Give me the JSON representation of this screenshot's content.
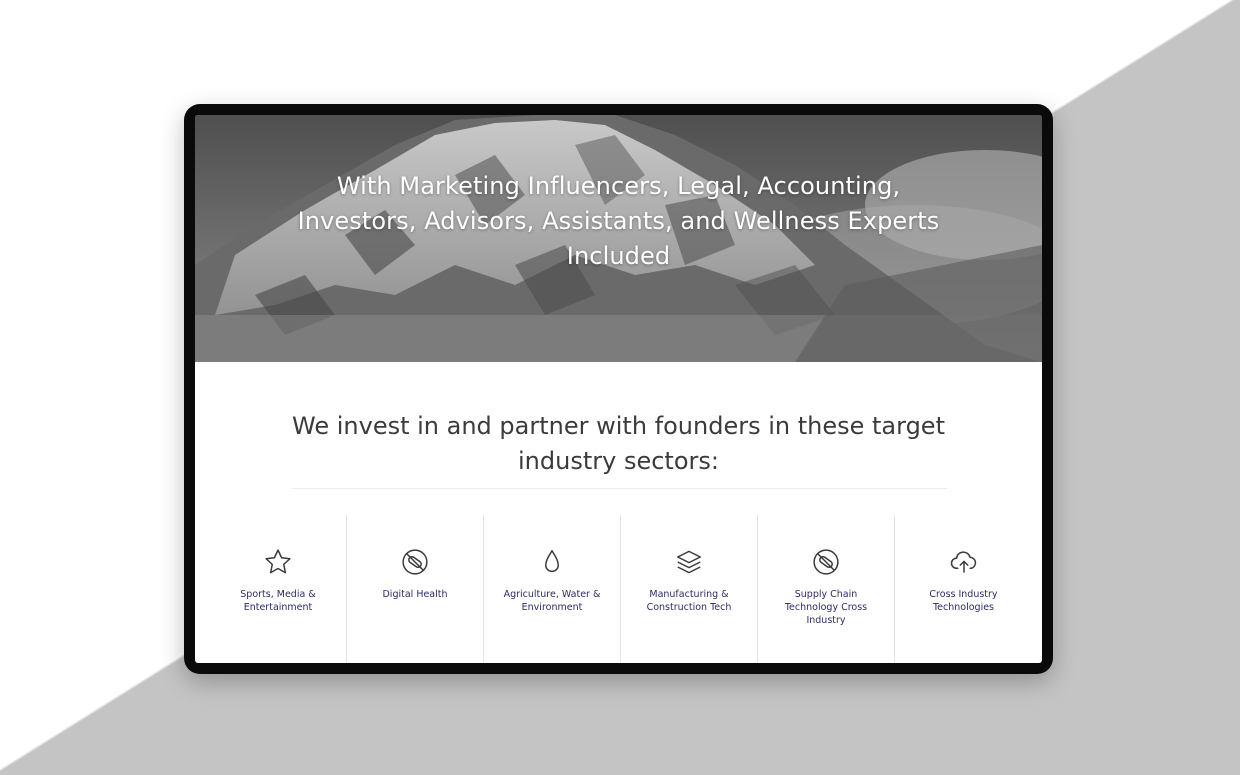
{
  "hero": {
    "headline": "With Marketing Influencers, Legal, Accounting, Investors, Advisors, Assistants, and Wellness Experts Included"
  },
  "sectors_section": {
    "heading": "We invest in and partner with founders in these target industry sectors:",
    "items": [
      {
        "label": "Sports, Media & Entertainment",
        "icon": "star-icon"
      },
      {
        "label": "Digital Health",
        "icon": "no-pill-icon"
      },
      {
        "label": "Agriculture, Water & Environment",
        "icon": "water-drop-icon"
      },
      {
        "label": "Manufacturing & Construction Tech",
        "icon": "layers-icon"
      },
      {
        "label": "Supply Chain Technology Cross Industry",
        "icon": "no-pill-icon"
      },
      {
        "label": "Cross Industry Technologies",
        "icon": "cloud-upload-icon"
      }
    ]
  },
  "colors": {
    "label": "#2e2a6b",
    "heading": "#3b3b3b",
    "frame": "#0a0a0a",
    "background_grey": "#c4c4c4"
  }
}
